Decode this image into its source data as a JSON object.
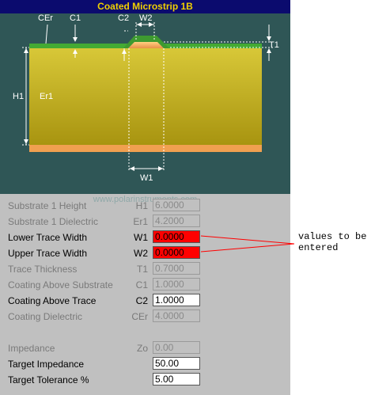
{
  "window": {
    "title": "Coated Microstrip 1B",
    "website": "www.polarinstruments.com"
  },
  "diagram": {
    "labels": {
      "cer": "CEr",
      "c1": "C1",
      "c2": "C2",
      "w2": "W2",
      "t1": "T1",
      "h1": "H1",
      "er1": "Er1",
      "w1": "W1"
    }
  },
  "fields": [
    {
      "label": "Substrate 1 Height",
      "symbol": "H1",
      "value": "6.0000",
      "state": "disabled"
    },
    {
      "label": "Substrate 1 Dielectric",
      "symbol": "Er1",
      "value": "4.2000",
      "state": "disabled"
    },
    {
      "label": "Lower Trace Width",
      "symbol": "W1",
      "value": "0.0000",
      "state": "highlight"
    },
    {
      "label": "Upper Trace Width",
      "symbol": "W2",
      "value": "0.0000",
      "state": "highlight"
    },
    {
      "label": "Trace Thickness",
      "symbol": "T1",
      "value": "0.7000",
      "state": "disabled"
    },
    {
      "label": "Coating Above Substrate",
      "symbol": "C1",
      "value": "1.0000",
      "state": "disabled"
    },
    {
      "label": "Coating Above Trace",
      "symbol": "C2",
      "value": "1.0000",
      "state": "active"
    },
    {
      "label": "Coating Dielectric",
      "symbol": "CEr",
      "value": "4.0000",
      "state": "disabled"
    }
  ],
  "results": [
    {
      "label": "Impedance",
      "symbol": "Zo",
      "value": "0.00",
      "state": "disabled"
    },
    {
      "label": "Target Impedance",
      "symbol": "",
      "value": "50.00",
      "state": "active"
    },
    {
      "label": "Target Tolerance %",
      "symbol": "",
      "value": "5.00",
      "state": "active"
    }
  ],
  "annotation": {
    "line1": "values to be",
    "line2": "entered"
  },
  "colors": {
    "titlebar_bg": "#0b0b6e",
    "title_text": "#f0d000",
    "diagram_bg": "#2f5656",
    "substrate": "#c8b428",
    "coating": "#44aa33",
    "ground": "#f0a050",
    "highlight_field": "#ff0000"
  }
}
